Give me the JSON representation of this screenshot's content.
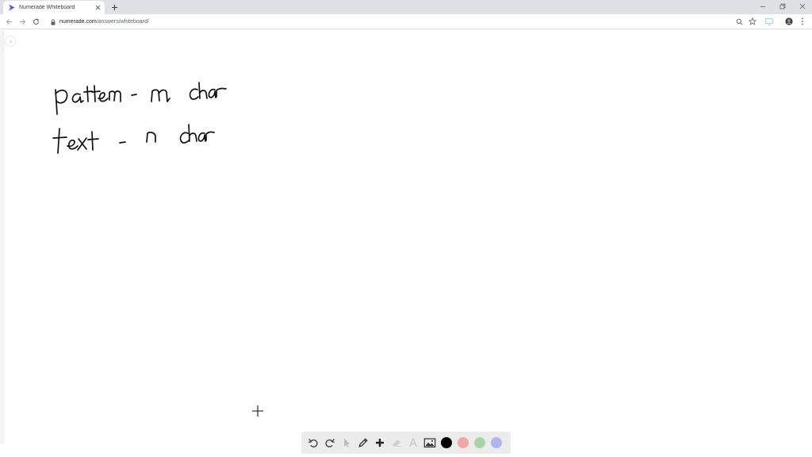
{
  "browser": {
    "tab_title": "Numerade Whiteboard",
    "url_host": "numerade.com",
    "url_path": "/answers/whiteboard/"
  },
  "whiteboard": {
    "handwriting": [
      "pattern - m char",
      "text - n char"
    ],
    "ink_color": "#111111"
  },
  "toolbar_tools": [
    "undo-icon",
    "redo-icon",
    "select-icon",
    "pen-icon",
    "add-icon",
    "eraser-icon",
    "text-icon",
    "image-icon"
  ],
  "colors": {
    "swatches": [
      "#000000",
      "#f0a8a8",
      "#a8d5a8",
      "#b3b3f0"
    ],
    "selected": "#000000",
    "brand": "#5a51e4"
  }
}
